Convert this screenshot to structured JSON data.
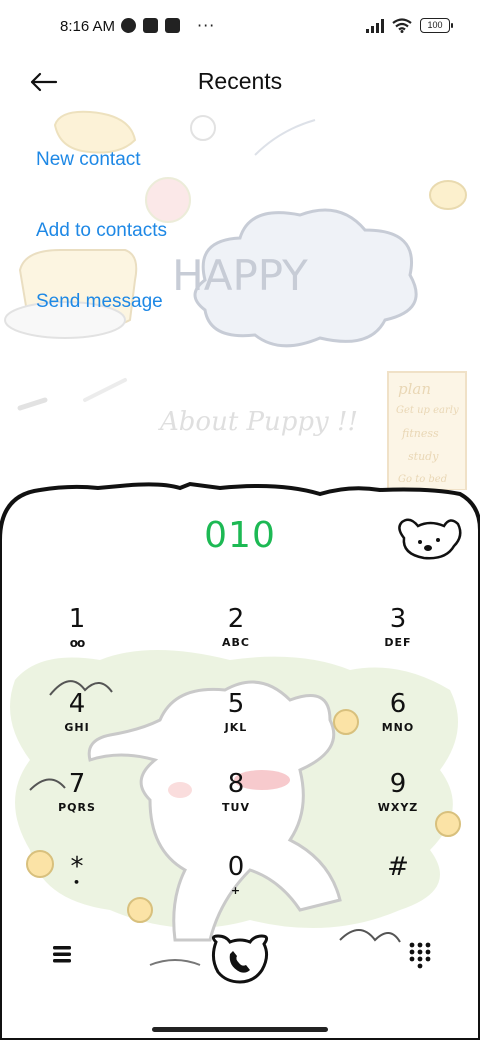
{
  "status_bar": {
    "time": "8:16 AM",
    "battery": "100",
    "dots": "···"
  },
  "header": {
    "title": "Recents",
    "back_icon": "arrow-left-icon"
  },
  "actions": {
    "new_contact": "New contact",
    "add_to_contacts": "Add to contacts",
    "send_message": "Send message"
  },
  "background_text": {
    "happy": "HAPPY",
    "about": "About Puppy !!",
    "plan_title": "plan",
    "plan_items": [
      "Get up early",
      "fitness",
      "study",
      "Go to bed"
    ]
  },
  "dialer": {
    "number": "010",
    "keys": [
      {
        "digit": "1",
        "letters": "oo"
      },
      {
        "digit": "2",
        "letters": "ABC"
      },
      {
        "digit": "3",
        "letters": "DEF"
      },
      {
        "digit": "4",
        "letters": "GHI"
      },
      {
        "digit": "5",
        "letters": "JKL"
      },
      {
        "digit": "6",
        "letters": "MNO"
      },
      {
        "digit": "7",
        "letters": "PQRS"
      },
      {
        "digit": "8",
        "letters": "TUV"
      },
      {
        "digit": "9",
        "letters": "WXYZ"
      },
      {
        "digit": "*",
        "letters": "•"
      },
      {
        "digit": "0",
        "letters": "+"
      },
      {
        "digit": "#",
        "letters": ""
      }
    ]
  },
  "colors": {
    "link": "#1e88e5",
    "number": "#1db954"
  }
}
